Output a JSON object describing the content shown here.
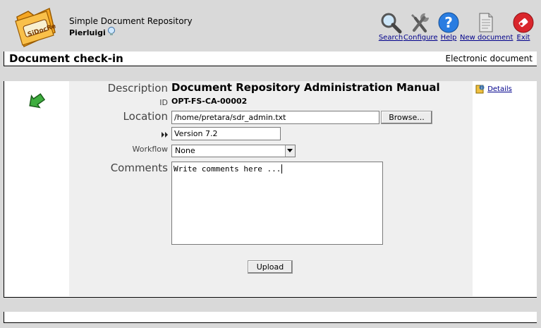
{
  "header": {
    "logo_text": "SiDocRe",
    "app_title": "Simple Document Repository",
    "user_name": "Pierluigi"
  },
  "toolbar": {
    "items": [
      {
        "label": "Search",
        "icon": "search-icon"
      },
      {
        "label": "Configure",
        "icon": "configure-icon"
      },
      {
        "label": "Help",
        "icon": "help-icon"
      },
      {
        "label": "New document",
        "icon": "new-document-icon"
      },
      {
        "label": "Exit",
        "icon": "exit-icon"
      }
    ]
  },
  "titlebar": {
    "title": "Document check-in",
    "subtitle": "Electronic document"
  },
  "form": {
    "description_label": "Description",
    "description_value": "Document Repository Administration Manual",
    "id_label": "ID",
    "id_value": "OPT-FS-CA-00002",
    "location_label": "Location",
    "location_value": "/home/pretara/sdr_admin.txt",
    "browse_label": "Browse...",
    "version_value": "Version 7.2",
    "workflow_label": "Workflow",
    "workflow_value": "None",
    "comments_label": "Comments",
    "comments_value": "Write comments here ...",
    "upload_label": "Upload"
  },
  "details": {
    "label": "Details"
  },
  "colors": {
    "background": "#d9d9d9",
    "panel": "#ffffff",
    "panel_center": "#efefef",
    "link": "#00008b"
  }
}
